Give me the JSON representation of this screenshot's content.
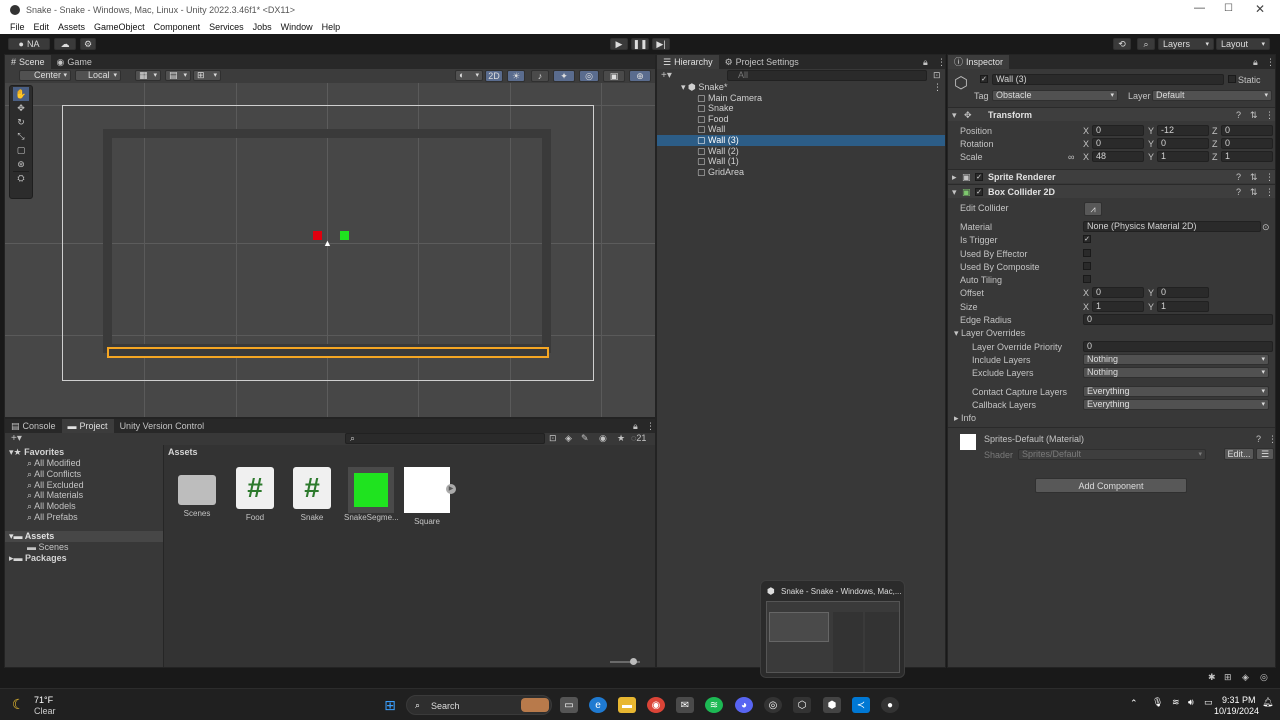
{
  "window": {
    "title": "Snake - Snake - Windows, Mac, Linux - Unity 2022.3.46f1* <DX11>"
  },
  "menu": [
    "File",
    "Edit",
    "Assets",
    "GameObject",
    "Component",
    "Services",
    "Jobs",
    "Window",
    "Help"
  ],
  "toolbar": {
    "account": "NA",
    "layers_label": "Layers",
    "layout_label": "Layout"
  },
  "scene": {
    "tabs": [
      "Scene",
      "Game"
    ],
    "pivot": "Center",
    "space": "Local",
    "mode2d": "2D",
    "food_color": "#e0000e",
    "snake_color": "#1fe31f",
    "selection_color": "#f5a623"
  },
  "hierarchy": {
    "tabs": [
      "Hierarchy",
      "Project Settings"
    ],
    "search_placeholder": "All",
    "scene_name": "Snake*",
    "items": [
      "Main Camera",
      "Snake",
      "Food",
      "Wall",
      "Wall (3)",
      "Wall (2)",
      "Wall (1)",
      "GridArea"
    ],
    "selected_index": 4
  },
  "inspector": {
    "tab": "Inspector",
    "object_name": "Wall (3)",
    "static_label": "Static",
    "tag_label": "Tag",
    "tag": "Obstacle",
    "layer_label": "Layer",
    "layer": "Default",
    "transform": {
      "title": "Transform",
      "rows": [
        {
          "label": "Position",
          "x": "0",
          "y": "-12",
          "z": "0"
        },
        {
          "label": "Rotation",
          "x": "0",
          "y": "0",
          "z": "0"
        },
        {
          "label": "Scale",
          "x": "48",
          "y": "1",
          "z": "1"
        }
      ]
    },
    "sprite_renderer": "Sprite Renderer",
    "box_collider": {
      "title": "Box Collider 2D",
      "edit_collider": "Edit Collider",
      "material_label": "Material",
      "material": "None (Physics Material 2D)",
      "is_trigger": "Is Trigger",
      "used_by_effector": "Used By Effector",
      "used_by_composite": "Used By Composite",
      "auto_tiling": "Auto Tiling",
      "offset_label": "Offset",
      "offset": {
        "x": "0",
        "y": "0"
      },
      "size_label": "Size",
      "size": {
        "x": "1",
        "y": "1"
      },
      "edge_radius_label": "Edge Radius",
      "edge_radius": "0",
      "layer_overrides": "Layer Overrides",
      "layer_override_priority_label": "Layer Override Priority",
      "layer_override_priority": "0",
      "include_layers_label": "Include Layers",
      "include_layers": "Nothing",
      "exclude_layers_label": "Exclude Layers",
      "exclude_layers": "Nothing",
      "contact_capture_label": "Contact Capture Layers",
      "contact_capture": "Everything",
      "callback_label": "Callback Layers",
      "callback": "Everything",
      "info": "Info"
    },
    "material": {
      "name": "Sprites-Default (Material)",
      "shader_label": "Shader",
      "shader": "Sprites/Default",
      "edit": "Edit..."
    },
    "add_component": "Add Component"
  },
  "project": {
    "tabs": [
      "Console",
      "Project",
      "Unity Version Control"
    ],
    "count": "21",
    "favorites_title": "Favorites",
    "favorites": [
      "All Modified",
      "All Conflicts",
      "All Excluded",
      "All Materials",
      "All Models",
      "All Prefabs"
    ],
    "assets_title": "Assets",
    "assets_children": [
      "Scenes"
    ],
    "packages": "Packages",
    "breadcrumb": "Assets",
    "items": [
      {
        "name": "Scenes",
        "kind": "folder"
      },
      {
        "name": "Food",
        "kind": "script"
      },
      {
        "name": "Snake",
        "kind": "script"
      },
      {
        "name": "SnakeSegme...",
        "kind": "prefab"
      },
      {
        "name": "Square",
        "kind": "sprite"
      }
    ]
  },
  "thumbnail": {
    "title": "Snake - Snake - Windows, Mac,..."
  },
  "taskbar": {
    "temperature": "71°F",
    "weather": "Clear",
    "search": "Search",
    "time": "9:31 PM",
    "date": "10/19/2024"
  }
}
